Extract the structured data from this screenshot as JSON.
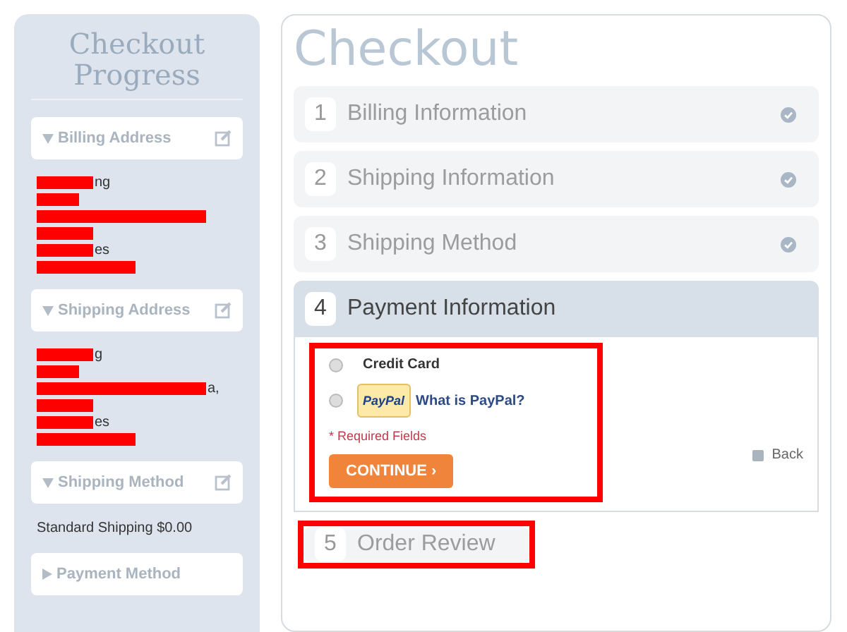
{
  "sidebar": {
    "title": "Checkout Progress",
    "sections": [
      {
        "label": "Billing Address",
        "expanded": true,
        "editable": true,
        "lines": [
          {
            "kind": "redacted",
            "text": "ng"
          },
          {
            "kind": "redacted"
          },
          {
            "kind": "redacted"
          },
          {
            "kind": "redacted"
          },
          {
            "kind": "redacted",
            "text": "es"
          },
          {
            "kind": "redacted"
          }
        ]
      },
      {
        "label": "Shipping Address",
        "expanded": true,
        "editable": true,
        "lines": [
          {
            "kind": "redacted",
            "text": "g"
          },
          {
            "kind": "redacted"
          },
          {
            "kind": "redacted",
            "text": "a,"
          },
          {
            "kind": "redacted"
          },
          {
            "kind": "redacted",
            "text": "es"
          },
          {
            "kind": "redacted"
          }
        ]
      },
      {
        "label": "Shipping Method",
        "expanded": true,
        "editable": true,
        "text": "Standard Shipping $0.00"
      },
      {
        "label": "Payment Method",
        "expanded": false,
        "editable": false
      }
    ]
  },
  "title": "Checkout",
  "steps": [
    {
      "number": "1",
      "label": "Billing Information",
      "complete": true,
      "active": false,
      "highlighted": false
    },
    {
      "number": "2",
      "label": "Shipping Information",
      "complete": true,
      "active": false,
      "highlighted": false
    },
    {
      "number": "3",
      "label": "Shipping Method",
      "complete": true,
      "active": false,
      "highlighted": false
    },
    {
      "number": "4",
      "label": "Payment Information",
      "complete": false,
      "active": true,
      "highlighted": false
    },
    {
      "number": "5",
      "label": "Order Review",
      "complete": false,
      "active": false,
      "highlighted": true
    }
  ],
  "payment": {
    "highlighted": true,
    "options": [
      {
        "kind": "text",
        "label": "Credit Card",
        "selected": false
      },
      {
        "kind": "paypal",
        "badge": "PayPal",
        "link": "What is PayPal?",
        "selected": false
      }
    ],
    "required_note": "* Required Fields",
    "continue_button": "CONTINUE ›",
    "back_link": "Back"
  }
}
